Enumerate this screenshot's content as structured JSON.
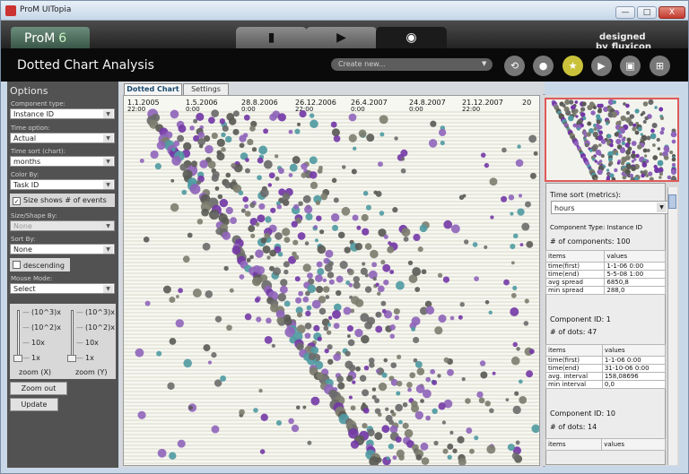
{
  "window": {
    "title": "ProM UITopia",
    "minimize": "—",
    "maximize": "□",
    "close": "X"
  },
  "topbar": {
    "logo_text": "ProM",
    "logo_version": "6",
    "tabs": [
      {
        "name": "workspace-icon",
        "icon": "▮"
      },
      {
        "name": "play-icon",
        "icon": "▶"
      },
      {
        "name": "eye-icon",
        "icon": "◉"
      }
    ],
    "brand_prefix": "designed by",
    "brand_name": "fluxicon"
  },
  "header": {
    "title": "Dotted Chart Analysis",
    "create_placeholder": "Create new...",
    "toolbar_icons": [
      "sync-icon",
      "drop-icon",
      "star-icon",
      "play-icon",
      "copy-icon",
      "grid-icon"
    ],
    "toolbar_glyphs": [
      "⟲",
      "●",
      "★",
      "▶",
      "▣",
      "⊞"
    ]
  },
  "options": {
    "title": "Options",
    "component_type": {
      "label": "Component type:",
      "value": "Instance ID"
    },
    "time_option": {
      "label": "Time option:",
      "value": "Actual"
    },
    "time_sort_chart": {
      "label": "Time sort (chart):",
      "value": "months"
    },
    "color_by": {
      "label": "Color By:",
      "value": "Task ID"
    },
    "size_shows": {
      "label": "Size shows # of events",
      "checked": true
    },
    "size_shape_by": {
      "label": "Size/Shape By:",
      "value": "None"
    },
    "sort_by": {
      "label": "Sort By:",
      "value": "None"
    },
    "descending": {
      "label": "descending",
      "checked": false
    },
    "mouse_mode": {
      "label": "Mouse Mode:",
      "value": "Select"
    },
    "zoom_x": {
      "ticks": [
        "(10^3)x",
        "(10^2)x",
        "10x",
        "1x"
      ],
      "label": "zoom (X)"
    },
    "zoom_y": {
      "ticks": [
        "(10^3)x",
        "(10^2)x",
        "10x",
        "1x"
      ],
      "label": "zoom (Y)"
    },
    "zoom_out": "Zoom out",
    "update": "Update"
  },
  "chart_tabs": [
    "Dotted Chart",
    "Settings"
  ],
  "axis": {
    "labels": [
      "1.1.2005",
      "1.5.2006",
      "28.8.2006",
      "26.12.2006",
      "26.4.2007",
      "24.8.2007",
      "21.12.2007",
      "20"
    ],
    "sublabels": [
      "22:00",
      "0:00",
      "0:00",
      "22:00",
      "0:00",
      "0:00",
      "22:00",
      ""
    ]
  },
  "right_panel": {
    "time_sort_label": "Time sort (metrics):",
    "time_sort_value": "hours",
    "component_type": "Component Type: Instance ID",
    "num_components": "# of components: 100",
    "table_headers": [
      "items",
      "values"
    ],
    "summary_rows": [
      [
        "time(first)",
        "1-1-06 0:00"
      ],
      [
        "time(end)",
        "5-5-08 1:00"
      ],
      [
        "avg spread",
        "6850,8"
      ],
      [
        "min spread",
        "288,0"
      ]
    ],
    "component_1": "Component ID: 1",
    "dots_1": "# of dots: 47",
    "component_rows": [
      [
        "time(first)",
        "1-1-06 0:00"
      ],
      [
        "time(end)",
        "31-10-06 0:00"
      ],
      [
        "avg. interval",
        "158,08696"
      ],
      [
        "min interval",
        "0,0"
      ]
    ],
    "component_10": "Component ID: 10",
    "dots_10": "# of dots: 14"
  },
  "colors": {
    "accent": "#c9c23a",
    "purple": "#7338a6",
    "teal": "#4f9aa2",
    "gray": "#5a5a55"
  }
}
